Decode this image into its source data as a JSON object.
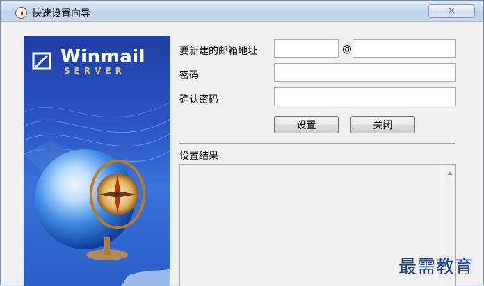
{
  "window": {
    "title": "快速设置向导",
    "close_glyph": "✕"
  },
  "banner": {
    "brand": "Winmail",
    "brand_sub": "SERVER"
  },
  "form": {
    "email_label": "要新建的邮箱地址",
    "at_sign": "@",
    "username_value": "",
    "domain_value": "",
    "password_label": "密码",
    "password_value": "",
    "confirm_label": "确认密码",
    "confirm_value": "",
    "set_button": "设置",
    "close_button": "关闭"
  },
  "result": {
    "label": "设置结果",
    "content": ""
  },
  "watermark": "最需教育",
  "colors": {
    "banner_blue": "#2a55c4",
    "title_bar": "#c9daf0",
    "watermark": "#1d3c8f"
  }
}
